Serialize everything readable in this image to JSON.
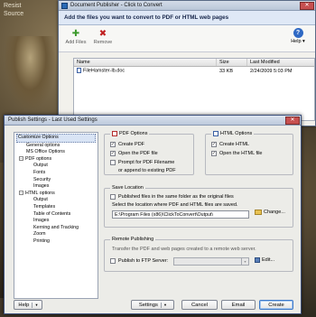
{
  "desktop": {
    "text_lines": [
      "Resist",
      "Source"
    ]
  },
  "doc_publisher": {
    "title": "Document Publisher - Click to Convert",
    "close_label": "✕",
    "header": "Add the files you want to convert to PDF or HTML web pages",
    "toolbar": {
      "add_label": "Add Files",
      "add_icon": "green-plus-icon",
      "remove_label": "Remove",
      "remove_icon": "red-x-icon",
      "help_label": "Help",
      "help_caret": "▾"
    },
    "table": {
      "columns": [
        "Name",
        "Size",
        "Last Modified"
      ],
      "rows": [
        {
          "name": "FileHamster-lb.doc",
          "size": "33 KB",
          "modified": "2/24/2009 5:03 PM"
        }
      ]
    }
  },
  "publish_settings": {
    "title": "Publish Settings - Last Used Settings",
    "close_label": "✕",
    "tree": [
      {
        "label": "Customize Options",
        "level": 0,
        "selected": true
      },
      {
        "label": "General options",
        "level": 1
      },
      {
        "label": "MS Office Options",
        "level": 1
      },
      {
        "label": "PDF options",
        "level": 1,
        "toggle": "−"
      },
      {
        "label": "Output",
        "level": 2
      },
      {
        "label": "Fonts",
        "level": 2
      },
      {
        "label": "Security",
        "level": 2
      },
      {
        "label": "Images",
        "level": 2
      },
      {
        "label": "HTML options",
        "level": 1,
        "toggle": "−"
      },
      {
        "label": "Output",
        "level": 2
      },
      {
        "label": "Templates",
        "level": 2
      },
      {
        "label": "Table of Contents",
        "level": 2
      },
      {
        "label": "Images",
        "level": 2
      },
      {
        "label": "Kerning and Tracking",
        "level": 2
      },
      {
        "label": "Zoom",
        "level": 2
      },
      {
        "label": "Printing",
        "level": 2
      }
    ],
    "pdf_options": {
      "title": "PDF Options",
      "create_pdf": "Create PDF",
      "open_pdf": "Open the PDF file",
      "prompt": "Prompt for PDF Filename",
      "append": "or append to existing PDF"
    },
    "html_options": {
      "title": "HTML Options",
      "create_html": "Create HTML",
      "open_html": "Open the HTML file"
    },
    "save_location": {
      "title": "Save Location",
      "same_folder": "Published files in the same folder as the original files",
      "select_text": "Select the location where PDF and HTML files are saved.",
      "path": "E:\\Program Files (x86)\\ClickToConvert\\Output\\",
      "change_label": "Change..."
    },
    "remote": {
      "title": "Remote Publishing",
      "desc": "Transfer the PDF and web pages created to a remote web server.",
      "ftp_label": "Publish to FTP Server:",
      "edit_label": "Edit..."
    },
    "checkmark": "✓",
    "buttons": {
      "help": "Help",
      "settings": "Settings",
      "cancel": "Cancel",
      "email": "Email",
      "create": "Create",
      "caret": "▾"
    }
  }
}
